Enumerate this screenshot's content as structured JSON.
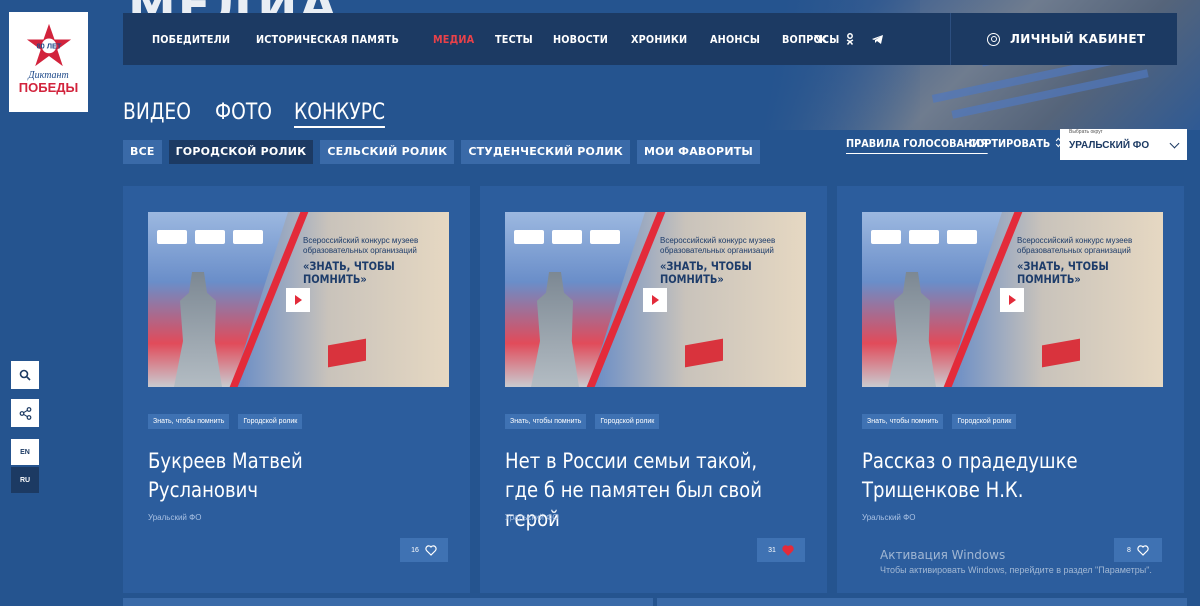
{
  "hero": {
    "title": "МЕДИА"
  },
  "logo": {
    "line1": "Диктант",
    "line2": "ПОБЕДЫ",
    "badge": "80 ЛЕТ"
  },
  "nav": {
    "items": [
      "ПОБЕДИТЕЛИ",
      "ИСТОРИЧЕСКАЯ ПАМЯТЬ",
      "МЕДИА",
      "ТЕСТЫ",
      "НОВОСТИ",
      "ХРОНИКИ",
      "АНОНСЫ",
      "ВОПРОСЫ"
    ],
    "active_index": 2,
    "socials": [
      "vk-icon",
      "ok-icon",
      "telegram-icon"
    ],
    "cabinet": "ЛИЧНЫЙ КАБИНЕТ"
  },
  "sections": [
    "ВИДЕО",
    "ФОТО",
    "КОНКУРС"
  ],
  "filters": [
    "ВСЕ",
    "ГОРОДСКОЙ РОЛИК",
    "СЕЛЬСКИЙ РОЛИК",
    "СТУДЕНЧЕСКИЙ РОЛИК",
    "МОИ ФАВОРИТЫ"
  ],
  "controls": {
    "rules": "ПРАВИЛА ГОЛОСОВАНИЯ",
    "sort": "СОРТИРОВАТЬ",
    "select_label": "Выбрать округ",
    "select_value": "УРАЛЬСКИЙ ФО"
  },
  "sidebar": {
    "lang_en": "EN",
    "lang_ru": "RU"
  },
  "thumb_text": {
    "subtitle": "Всероссийский конкурс музеев образовательных организаций",
    "title": "«ЗНАТЬ, ЧТОБЫ ПОМНИТЬ»"
  },
  "cards": [
    {
      "tags": [
        "Знать, чтобы помнить",
        "Городской ролик"
      ],
      "name": "Букреев Матвей Русланович",
      "region": "Уральский ФО",
      "likes": "16",
      "liked": false
    },
    {
      "tags": [
        "Знать, чтобы помнить",
        "Городской ролик"
      ],
      "name": "Нет в России семьи такой, где б не памятен был свой герой",
      "region": "Уральский ФО",
      "likes": "31",
      "liked": true
    },
    {
      "tags": [
        "Знать, чтобы помнить",
        "Городской ролик"
      ],
      "name": "Рассказ о прадедушке Трищенкове Н.К.",
      "region": "Уральский ФО",
      "likes": "8",
      "liked": false
    }
  ],
  "watermark": {
    "line1": "Активация Windows",
    "line2": "Чтобы активировать Windows, перейдите в раздел \"Параметры\"."
  },
  "colors": {
    "accent": "#e84149",
    "bg": "#25548f",
    "nav": "#1c3a63",
    "card": "#2c5d9d"
  }
}
